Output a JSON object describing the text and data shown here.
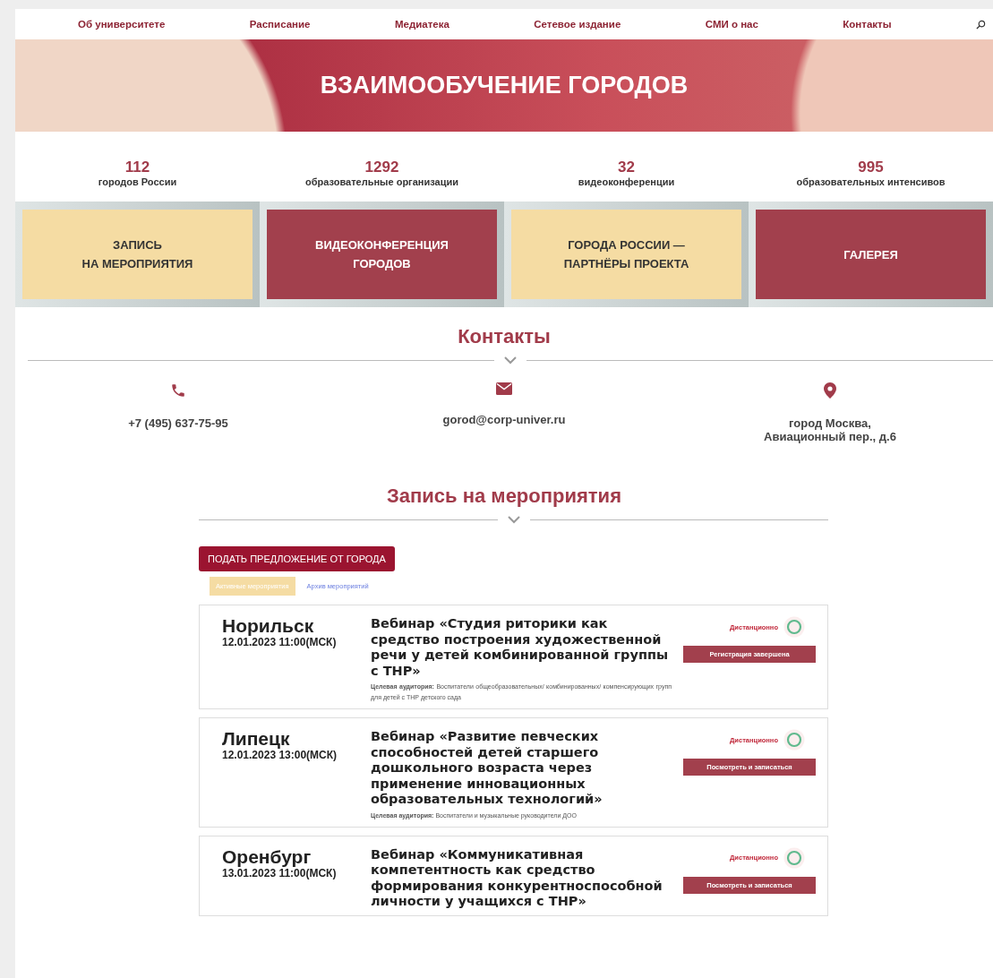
{
  "nav": {
    "items": [
      "Об университете",
      "Расписание",
      "Медиатека",
      "Сетевое издание",
      "СМИ о нас",
      "Контакты"
    ]
  },
  "banner": {
    "title": "ВЗАИМООБУЧЕНИЕ ГОРОДОВ"
  },
  "stats": [
    {
      "value": "112",
      "label": "городов России"
    },
    {
      "value": "1292",
      "label": "образовательные организации"
    },
    {
      "value": "32",
      "label": "видеоконференции"
    },
    {
      "value": "995",
      "label": "образовательных интенсивов"
    }
  ],
  "tiles": [
    {
      "kind": "light",
      "lines": [
        "ЗАПИСЬ",
        "НА МЕРОПРИЯТИЯ"
      ]
    },
    {
      "kind": "dark",
      "lines": [
        "ВИДЕОКОНФЕРЕНЦИЯ",
        "ГОРОДОВ"
      ]
    },
    {
      "kind": "light",
      "lines": [
        "ГОРОДА РОССИИ —",
        "ПАРТНЁРЫ ПРОЕКТА"
      ]
    },
    {
      "kind": "dark",
      "lines": [
        "ГАЛЕРЕЯ"
      ]
    }
  ],
  "contacts": {
    "title": "Контакты",
    "items": [
      {
        "kind": "phone",
        "text": "+7 (495) 637-75-95"
      },
      {
        "kind": "email",
        "text": "gorod@corp-univer.ru"
      },
      {
        "kind": "address",
        "text": "город Москва,\nАвиационный пер., д.6"
      }
    ]
  },
  "events": {
    "title": "Запись на мероприятия",
    "propose_button": "ПОДАТЬ ПРЕДЛОЖЕНИЕ ОТ ГОРОДА",
    "tabs": [
      {
        "label": "Активные мероприятия",
        "selected": true
      },
      {
        "label": "Архив мероприятий",
        "selected": false
      }
    ],
    "items": [
      {
        "city": "Норильск",
        "date": "12.01.2023 11:00(МСК)",
        "title": "Вебинар «Студия риторики как средство построения художественной речи у детей комбинированной группы с ТНР»",
        "audience": "**Целевая аудитория:** Воспитатели общеобразовательных/ комбинированных/ компенсирующих групп для детей с ТНР детского сада",
        "format": "Дистанционно",
        "action": "Регистрация завершена"
      },
      {
        "city": "Липецк",
        "date": "12.01.2023 13:00(МСК)",
        "title": "Вебинар «Развитие певческих способностей детей старшего дошкольного возраста через применение инновационных образовательных технологий»",
        "audience": "**Целевая аудитория:** Воспитатели и музыкальные руководители ДОО",
        "format": "Дистанционно",
        "action": "Посмотреть и записаться"
      },
      {
        "city": "Оренбург",
        "date": "13.01.2023 11:00(МСК)",
        "title": "Вебинар «Коммуникативная компетентность как средство формирования конкурентноспособной личности у учащихся с ТНР»",
        "format": "Дистанционно",
        "action": "Посмотреть и записаться"
      }
    ]
  }
}
